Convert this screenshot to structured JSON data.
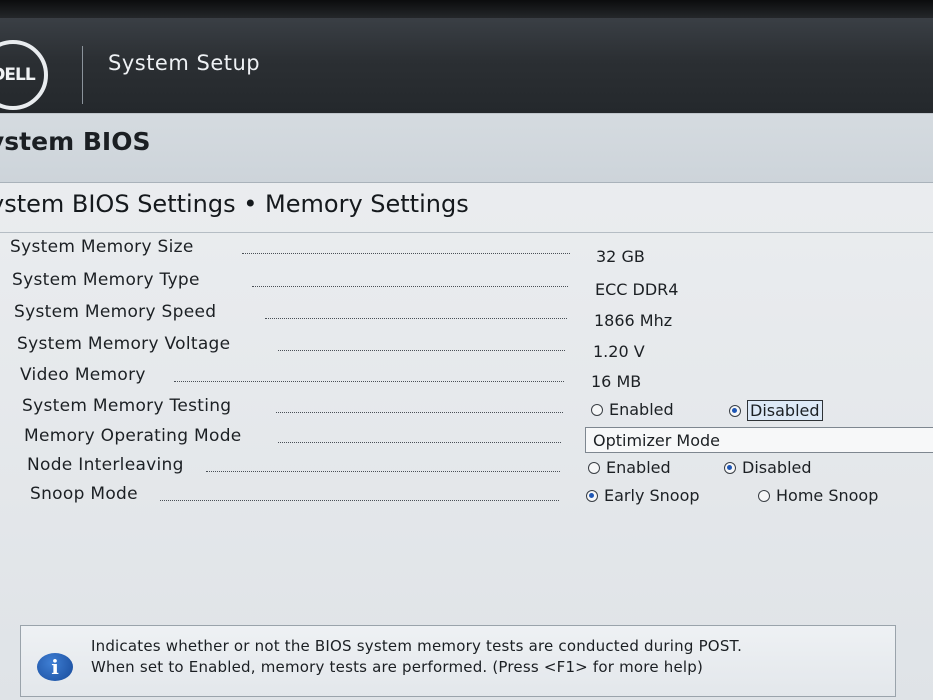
{
  "header": {
    "logo_text": "DELL",
    "app_title": "System Setup"
  },
  "section": {
    "title": "ystem BIOS"
  },
  "page": {
    "title": "ystem BIOS Settings • Memory Settings"
  },
  "settings": [
    {
      "label": "System Memory Size",
      "value": "32 GB"
    },
    {
      "label": "System Memory Type",
      "value": "ECC DDR4"
    },
    {
      "label": "System Memory Speed",
      "value": "1866 Mhz"
    },
    {
      "label": "System Memory Voltage",
      "value": "1.20 V"
    },
    {
      "label": "Video Memory",
      "value": "16 MB"
    },
    {
      "label": "System Memory Testing",
      "options": [
        "Enabled",
        "Disabled"
      ],
      "selected": "Disabled"
    },
    {
      "label": "Memory Operating Mode",
      "value": "Optimizer Mode"
    },
    {
      "label": "Node Interleaving",
      "options": [
        "Enabled",
        "Disabled"
      ],
      "selected": "Disabled"
    },
    {
      "label": "Snoop Mode",
      "options": [
        "Early Snoop",
        "Home Snoop"
      ],
      "selected": "Early Snoop"
    }
  ],
  "help": {
    "icon": "info-icon",
    "line1": "Indicates whether or not the BIOS system memory tests are conducted during POST.",
    "line2": "When set to Enabled, memory tests are performed. (Press <F1> for more help)"
  },
  "colors": {
    "header_bg": "#2b2f33",
    "page_bg": "#e8ebee",
    "radio_selected": "#1f57b5",
    "info_icon": "#2a63b8"
  }
}
